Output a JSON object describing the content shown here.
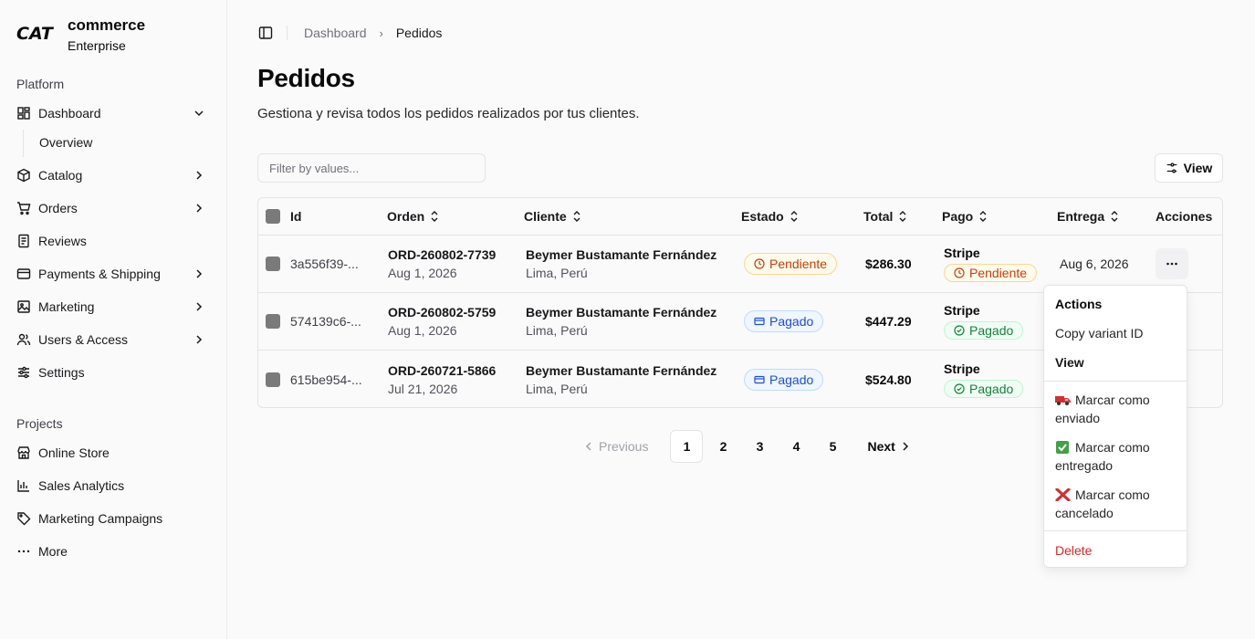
{
  "brand": {
    "name": "commerce",
    "subtitle": "Enterprise",
    "logo": "CAT"
  },
  "sidebar": {
    "platform_label": "Platform",
    "platform_items": [
      {
        "label": "Dashboard",
        "icon": "dashboard-icon",
        "expandable": true
      },
      {
        "label": "Catalog",
        "icon": "box-icon",
        "expandable": true
      },
      {
        "label": "Orders",
        "icon": "cart-icon",
        "expandable": true
      },
      {
        "label": "Reviews",
        "icon": "document-icon",
        "expandable": false
      },
      {
        "label": "Payments & Shipping",
        "icon": "credit-card-icon",
        "expandable": true
      },
      {
        "label": "Marketing",
        "icon": "image-icon",
        "expandable": true
      },
      {
        "label": "Users & Access",
        "icon": "users-icon",
        "expandable": true
      },
      {
        "label": "Settings",
        "icon": "sliders-icon",
        "expandable": false
      }
    ],
    "dashboard_sub": "Overview",
    "projects_label": "Projects",
    "project_items": [
      {
        "label": "Online Store",
        "icon": "store-icon"
      },
      {
        "label": "Sales Analytics",
        "icon": "bar-chart-icon"
      },
      {
        "label": "Marketing Campaigns",
        "icon": "tag-icon"
      },
      {
        "label": "More",
        "icon": "more-icon"
      }
    ]
  },
  "breadcrumb": {
    "parent": "Dashboard",
    "current": "Pedidos"
  },
  "page": {
    "title": "Pedidos",
    "description": "Gestiona y revisa todos los pedidos realizados por tus clientes."
  },
  "toolbar": {
    "filter_placeholder": "Filter by values...",
    "view_label": "View"
  },
  "table": {
    "columns": [
      "Id",
      "Orden",
      "Cliente",
      "Estado",
      "Total",
      "Pago",
      "Entrega",
      "Acciones"
    ],
    "rows": [
      {
        "id": "3a556f39-...",
        "order": "ORD-260802-7739",
        "order_date": "Aug 1, 2026",
        "client": "Beymer Bustamante Fernández",
        "location": "Lima, Perú",
        "status": "Pendiente",
        "total": "$286.30",
        "pay_method": "Stripe",
        "pay_status": "Pendiente",
        "delivery": "Aug 6, 2026"
      },
      {
        "id": "574139c6-...",
        "order": "ORD-260802-5759",
        "order_date": "Aug 1, 2026",
        "client": "Beymer Bustamante Fernández",
        "location": "Lima, Perú",
        "status": "Pagado",
        "total": "$447.29",
        "pay_method": "Stripe",
        "pay_status": "Pagado",
        "delivery": ""
      },
      {
        "id": "615be954-...",
        "order": "ORD-260721-5866",
        "order_date": "Jul 21, 2026",
        "client": "Beymer Bustamante Fernández",
        "location": "Lima, Perú",
        "status": "Pagado",
        "total": "$524.80",
        "pay_method": "Stripe",
        "pay_status": "Pagado",
        "delivery": ""
      }
    ]
  },
  "pagination": {
    "previous": "Previous",
    "pages": [
      "1",
      "2",
      "3",
      "4",
      "5"
    ],
    "current": "1",
    "next": "Next"
  },
  "actions_menu": {
    "label": "Actions",
    "copy": "Copy variant ID",
    "view": "View",
    "shipped": "Marcar como enviado",
    "delivered": "Marcar como entregado",
    "cancelled": "Marcar como cancelado",
    "delete": "Delete"
  },
  "colors": {
    "pending": "#c2410c",
    "paid_blue": "#1d4ed8",
    "paid_green": "#15803d",
    "danger": "#dc2626"
  }
}
